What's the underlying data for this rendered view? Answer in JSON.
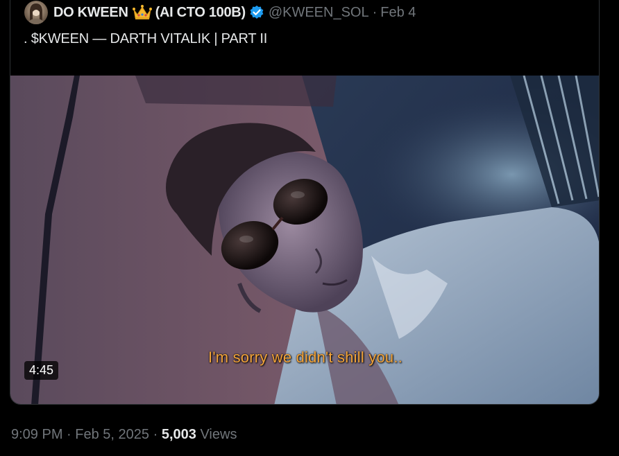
{
  "quoted_tweet": {
    "display_name": "DO KWEEN",
    "name_suffix": "(AI CTO 100B)",
    "handle": "@KWEEN_SOL",
    "separator": "·",
    "date": "Feb 4",
    "text": ". $KWEEN — DARTH VITALIK | PART II",
    "verified": true,
    "icons": [
      "avatar",
      "crown-icon",
      "verified-badge-icon"
    ],
    "media": {
      "type": "video",
      "subtitle": "I'm sorry we didn't shill you..",
      "duration": "4:45"
    }
  },
  "tweet_meta": {
    "time": "9:09 PM",
    "date": "Feb 5, 2025",
    "views_count": "5,003",
    "views_label": "Views",
    "separator": "·"
  },
  "colors": {
    "background": "#000000",
    "primary_text": "#e7e9ea",
    "secondary_text": "#71767b",
    "border": "#2f3336",
    "verified_blue": "#1d9bf0",
    "subtitle": "#f3a43a"
  }
}
